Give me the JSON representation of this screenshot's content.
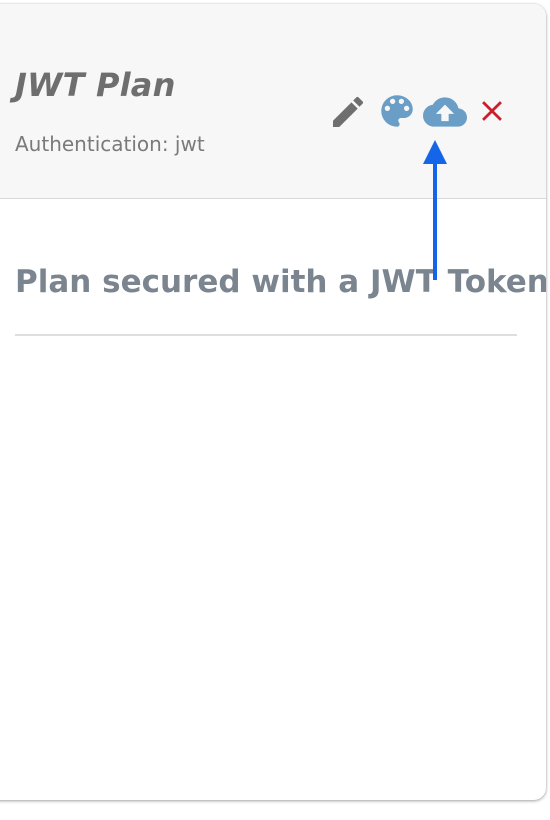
{
  "plan": {
    "title": "JWT Plan",
    "authentication": "Authentication: jwt",
    "description": "Plan secured with a JWT Token"
  },
  "actions": [
    {
      "name": "edit",
      "icon": "pencil-icon",
      "color": "#6f6f6f"
    },
    {
      "name": "design",
      "icon": "palette-icon",
      "color": "#6a9ec6"
    },
    {
      "name": "deploy",
      "icon": "cloud-upload-icon",
      "color": "#6a9ec6"
    },
    {
      "name": "close",
      "icon": "close-icon",
      "color": "#cc1f2e"
    }
  ],
  "annotation": {
    "icon": "arrow-up-icon",
    "color": "#1565e8"
  },
  "colors": {
    "header_bg": "#f7f7f7",
    "title": "#6e6e6e",
    "description": "#7b8590"
  }
}
